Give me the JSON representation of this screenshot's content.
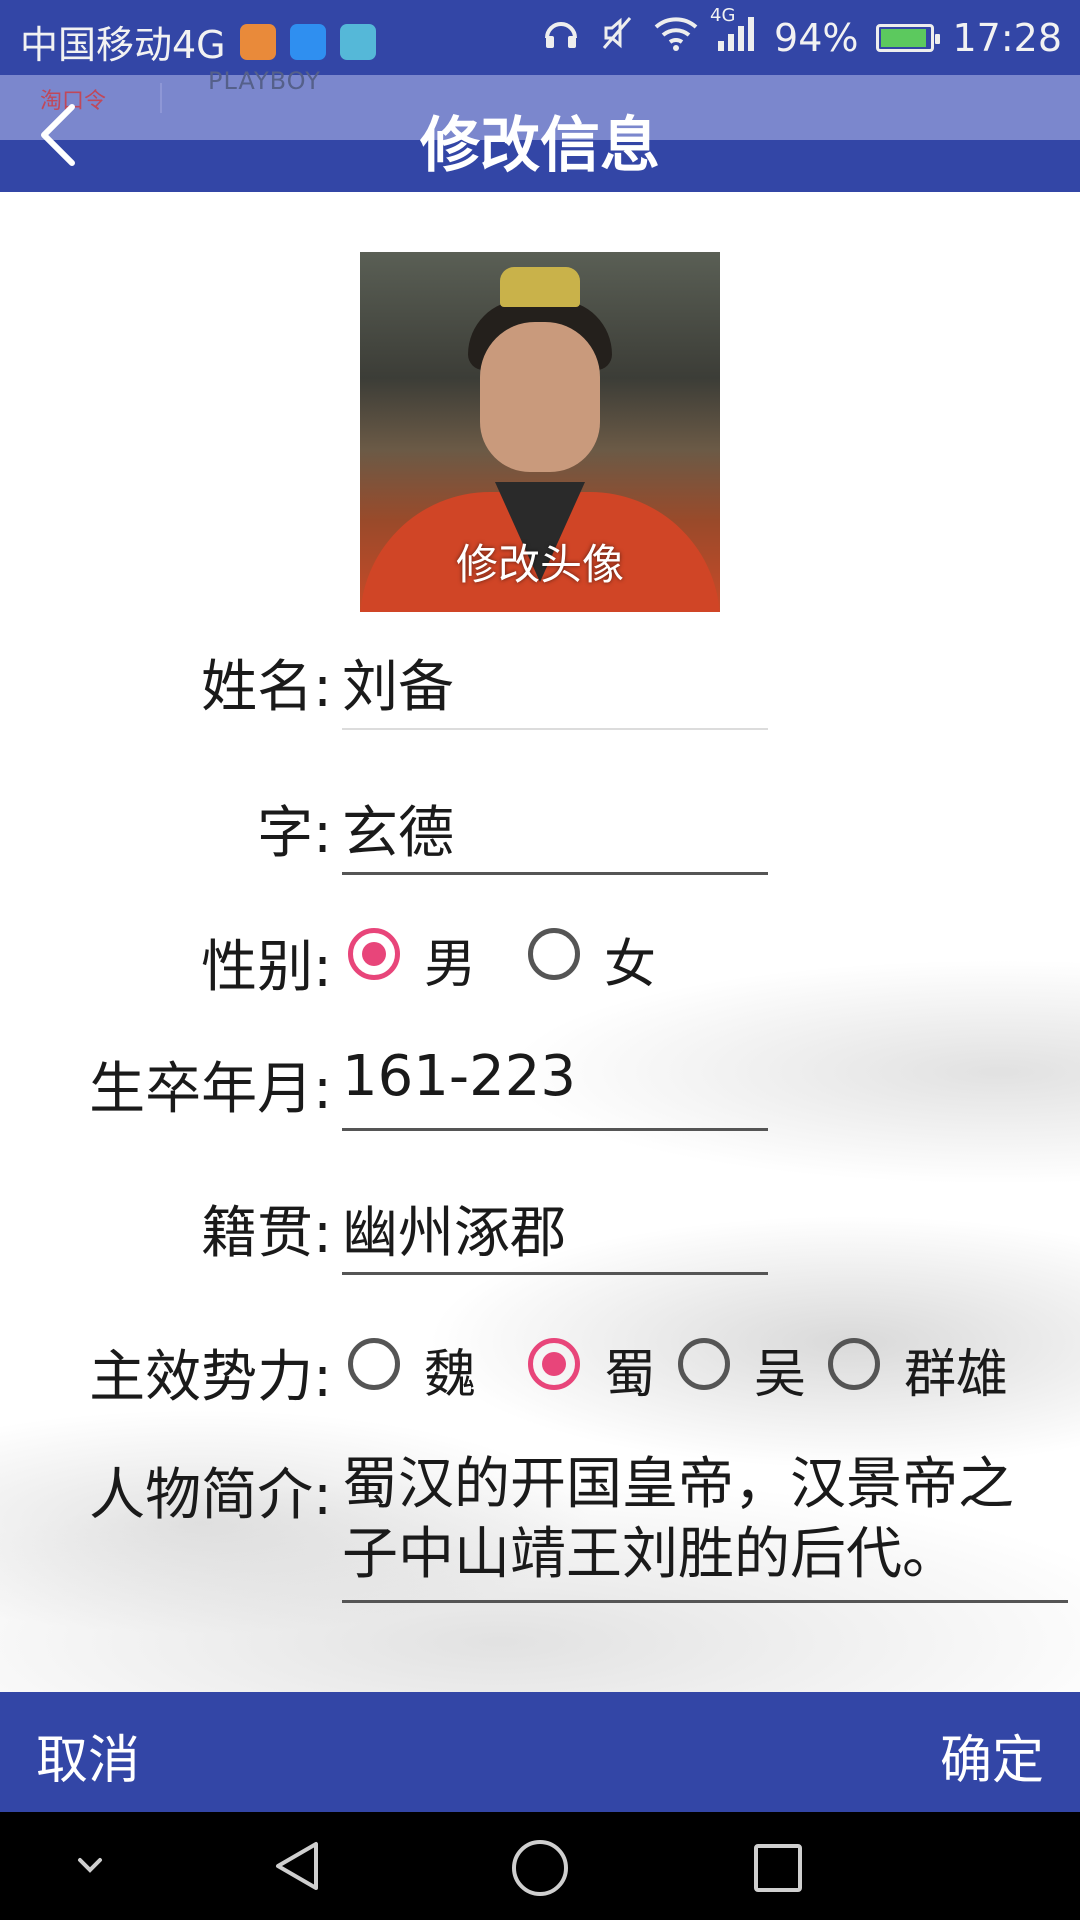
{
  "status_bar": {
    "carrier": "中国移动4G",
    "network_badge": "4G",
    "battery_percent": "94%",
    "time": "17:28",
    "battery_level": 0.86,
    "colors": {
      "background": "#3346a6"
    }
  },
  "notification_peek": {
    "left_text": "淘口令",
    "right_text": "PLAYBOY"
  },
  "header": {
    "title": "修改信息",
    "back_icon": "chevron-left-icon"
  },
  "avatar": {
    "caption": "修改头像"
  },
  "form": {
    "name": {
      "label": "姓名:",
      "value": "刘备"
    },
    "courtesy": {
      "label": "字:",
      "value": "玄德"
    },
    "gender": {
      "label": "性别:",
      "options": [
        "男",
        "女"
      ],
      "selected": "男"
    },
    "lifespan": {
      "label": "生卒年月:",
      "value": "161-223"
    },
    "origin": {
      "label": "籍贯:",
      "value": "幽州涿郡"
    },
    "faction": {
      "label": "主效势力:",
      "options": [
        "魏",
        "蜀",
        "吴",
        "群雄"
      ],
      "selected": "蜀"
    },
    "bio": {
      "label": "人物简介:",
      "value": "蜀汉的开国皇帝，汉景帝之子中山靖王刘胜的后代。"
    }
  },
  "actions": {
    "cancel": "取消",
    "confirm": "确定"
  },
  "colors": {
    "primary": "#3346a6",
    "accent": "#e8457a"
  }
}
